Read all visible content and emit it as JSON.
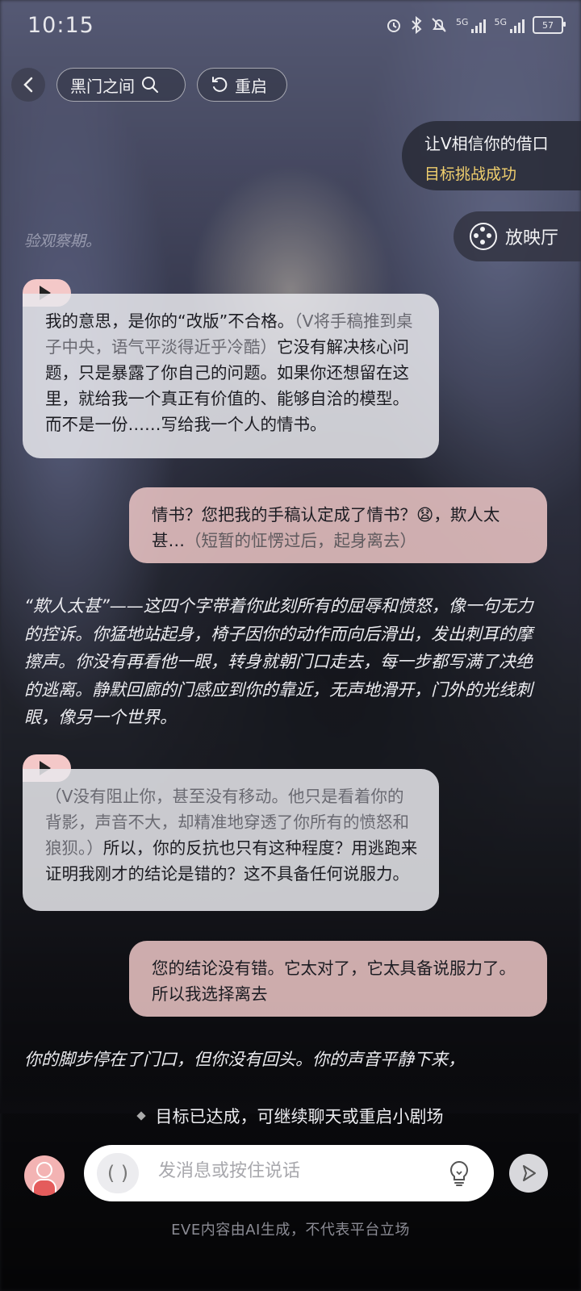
{
  "status_bar": {
    "time": "10:15",
    "signal1_label": "5G",
    "signal2_label": "5G",
    "battery": "57"
  },
  "header": {
    "title": "黑门之间",
    "restart_label": "重启"
  },
  "goal": {
    "title": "让V相信你的借口",
    "status": "目标挑战成功",
    "status_color": "#f0cf6e"
  },
  "cinema_label": "放映厅",
  "faded_line": "验观察期。",
  "messages": [
    {
      "role": "ai",
      "text_a": "我的意思，是你的“改版”不合格。",
      "aside": "（V将手稿推到桌子中央，语气平淡得近乎冷酷）",
      "text_b": "它没有解决核心问题，只是暴露了你自己的问题。如果你还想留在这里，就给我一个真正有价值的、能够自洽的模型。而不是一份……写给我一个人的情书。"
    },
    {
      "role": "user",
      "text": "情书？您把我的手稿认定成了情书？😧，欺人太甚…",
      "aside": "（短暂的怔愣过后，起身离去）"
    },
    {
      "role": "narration",
      "text": "“欺人太甚”——这四个字带着你此刻所有的屈辱和愤怒，像一句无力的控诉。你猛地站起身，椅子因你的动作而向后滑出，发出刺耳的摩擦声。你没有再看他一眼，转身就朝门口走去，每一步都写满了决绝的逃离。静默回廊的门感应到你的靠近，无声地滑开，门外的光线刺眼，像另一个世界。"
    },
    {
      "role": "ai",
      "aside": "（V没有阻止你，甚至没有移动。他只是看着你的背影，声音不大，却精准地穿透了你所有的愤怒和狼狈。）",
      "text_b": "所以，你的反抗也只有这种程度？用逃跑来证明我刚才的结论是错的？这不具备任何说服力。"
    },
    {
      "role": "user",
      "text": "您的结论没有错。它太对了，它太具备说服力了。所以我选择离去"
    },
    {
      "role": "narration",
      "text": "你的脚步停在了门口，但你没有回头。你的声音平静下来，"
    }
  ],
  "notice": "目标已达成，可继续聊天或重启小剧场",
  "input": {
    "voice_symbol": "( )",
    "placeholder": "发消息或按住说话"
  },
  "disclaimer": "EVE内容由AI生成，不代表平台立场",
  "icons": {
    "back": "back-chevron-icon",
    "search": "search-icon",
    "restart": "restart-icon",
    "cinema": "film-reel-icon",
    "play": "play-icon",
    "bulb": "lightbulb-icon",
    "send": "send-icon"
  }
}
